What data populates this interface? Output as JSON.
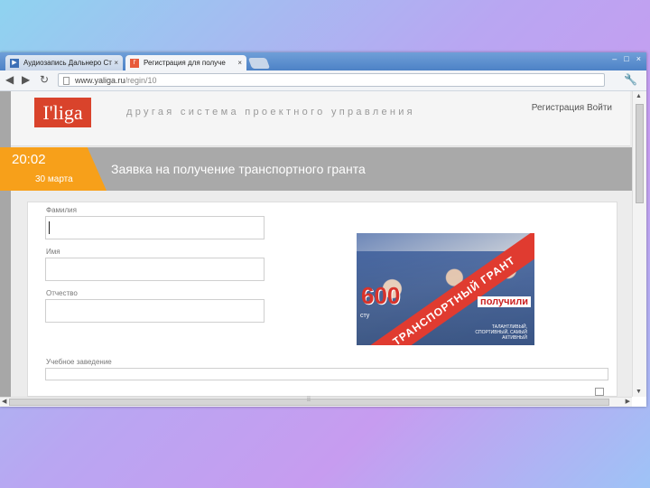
{
  "browser": {
    "tabs": [
      {
        "title": "Аудиозапись Дальнеро Ст",
        "active": false
      },
      {
        "title": "Регистрация для получе",
        "active": true
      }
    ],
    "close_glyph": "×",
    "window_controls": [
      "–",
      "□",
      "×"
    ],
    "url_domain": "www.yaliga.ru",
    "url_path": "/regin/10",
    "nav": {
      "back": "◀",
      "forward": "▶",
      "reload": "↻"
    },
    "menu_icon": "wrench-icon"
  },
  "site": {
    "logo": "I'liga",
    "tagline": "другая система проектного управления",
    "auth": {
      "register": "Регистрация",
      "separator": "  ",
      "login": "Войти"
    }
  },
  "banner": {
    "time": "20:02",
    "date": "30 марта",
    "title": "Заявка на получение транспортного гранта"
  },
  "form": {
    "fields": [
      {
        "label": "Фамилия",
        "value": ""
      },
      {
        "label": "Имя",
        "value": ""
      },
      {
        "label": "Отчество",
        "value": ""
      },
      {
        "label": "Учебное заведение",
        "value": ""
      }
    ]
  },
  "promo": {
    "big_number": "600",
    "ribbon": "ТРАНСПОРТНЫЙ ГРАНТ",
    "received": "получили",
    "stub": "сту",
    "fine_print": "ТАЛАНТЛИВЫЙ, СПОРТИВНЫЙ, САМЫЙ АКТИВНЫЙ"
  },
  "colors": {
    "accent_orange": "#f7a01a",
    "logo_red": "#d9432b",
    "banner_gray": "#a9a9a9"
  }
}
